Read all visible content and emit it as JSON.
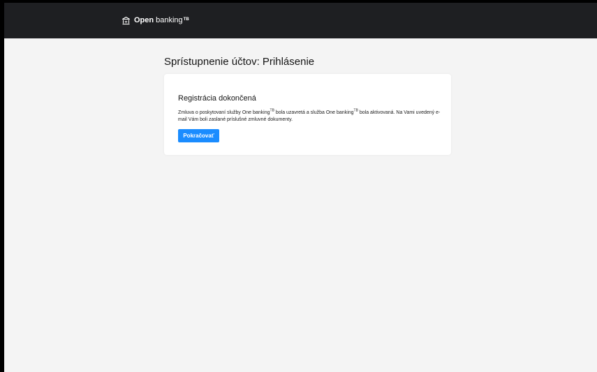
{
  "header": {
    "brand_bold": "Open",
    "brand_regular": "banking",
    "brand_sup": "TB",
    "brand_icon": "bank-icon"
  },
  "page": {
    "title": "Sprístupnenie účtov: Prihlásenie"
  },
  "card": {
    "title": "Registrácia dokončená",
    "text_part1": "Zmluva o poskytovaní služby One banking",
    "sup1": "TB",
    "text_part2": " bola uzavretá a služba One banking",
    "sup2": "TB",
    "text_part3": " bola aktivovaná. Na Vami uvedený e-mail Vám boli zaslané príslušné zmluvné dokumenty.",
    "button_label": "Pokračovať"
  },
  "colors": {
    "header_bg": "#1e1f22",
    "page_bg": "#f4f4f4",
    "accent": "#1a8cff"
  }
}
